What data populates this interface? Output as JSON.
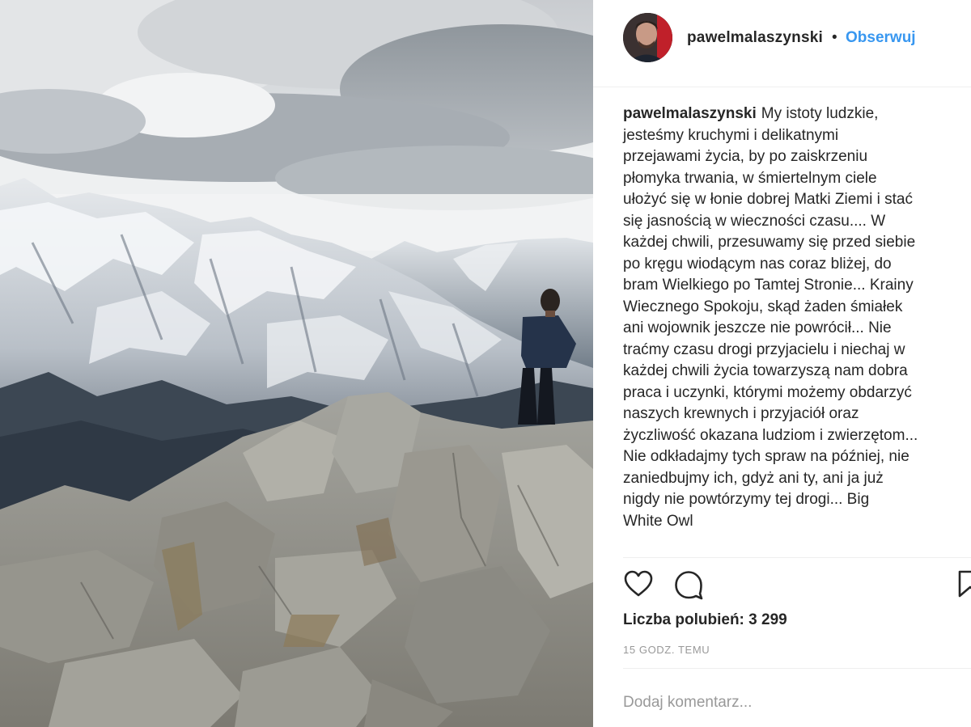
{
  "photo": {
    "description_icon": "mountain-photo"
  },
  "header": {
    "username": "pawelmalaszynski",
    "separator": "•",
    "follow_label": "Obserwuj"
  },
  "caption": {
    "username": "pawelmalaszynski",
    "lines": [
      "My istoty ludzkie,",
      "jesteśmy kruchymi i delikatnymi",
      "przejawami życia, by po zaiskrzeniu",
      "płomyka trwania, w śmiertelnym ciele",
      "ułożyć się w łonie dobrej Matki Ziemi i stać",
      "się jasnością w wieczności czasu.... W",
      "każdej chwili, przesuwamy się przed siebie",
      "po kręgu wiodącym nas coraz bliżej, do",
      "bram Wielkiego po Tamtej Stronie... Krainy",
      "Wiecznego Spokoju, skąd żaden śmiałek",
      "ani wojownik jeszcze nie powrócił... Nie",
      "traćmy czasu drogi przyjacielu i niechaj w",
      "każdej chwili życia towarzyszą nam dobra",
      "praca i uczynki, którymi możemy obdarzyć",
      "naszych krewnych i przyjaciół oraz",
      "życzliwość okazana ludziom i zwierzętom...",
      "Nie odkładajmy tych spraw na później, nie",
      "zaniedbujmy ich, gdyż ani ty, ani ja już",
      "nigdy nie powtórzymy tej drogi... Big",
      "White Owl"
    ]
  },
  "actions": {
    "like_icon": "heart-icon",
    "comment_icon": "comment-icon",
    "save_icon": "bookmark-icon"
  },
  "likes_text": "Liczba polubień: 3 299",
  "timestamp": "15 GODZ. TEMU",
  "comment_placeholder": "Dodaj komentarz...",
  "colors": {
    "link_blue": "#3897f0",
    "text": "#262626",
    "muted": "#999999",
    "divider": "#efefef"
  }
}
